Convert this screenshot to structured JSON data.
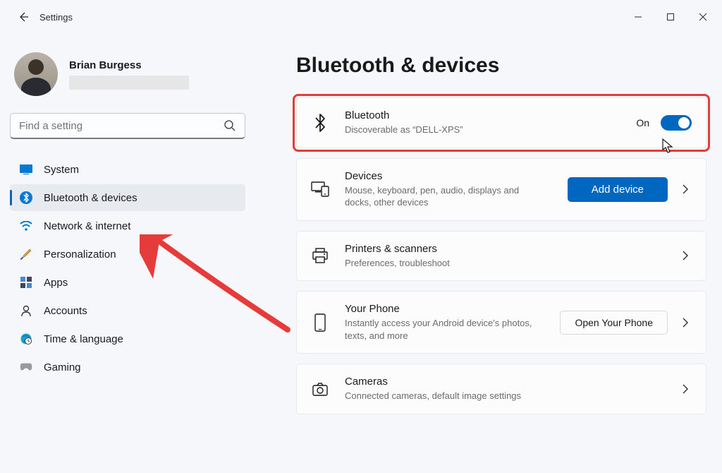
{
  "window": {
    "title": "Settings"
  },
  "profile": {
    "name": "Brian Burgess"
  },
  "search": {
    "placeholder": "Find a setting"
  },
  "nav": [
    {
      "id": "system",
      "label": "System"
    },
    {
      "id": "bluetooth",
      "label": "Bluetooth & devices"
    },
    {
      "id": "network",
      "label": "Network & internet"
    },
    {
      "id": "personalization",
      "label": "Personalization"
    },
    {
      "id": "apps",
      "label": "Apps"
    },
    {
      "id": "accounts",
      "label": "Accounts"
    },
    {
      "id": "time",
      "label": "Time & language"
    },
    {
      "id": "gaming",
      "label": "Gaming"
    }
  ],
  "page": {
    "title": "Bluetooth & devices"
  },
  "cards": {
    "bluetooth": {
      "title": "Bluetooth",
      "subtitle": "Discoverable as “DELL-XPS”",
      "toggle_label": "On",
      "toggle_state": true
    },
    "devices": {
      "title": "Devices",
      "subtitle": "Mouse, keyboard, pen, audio, displays and docks, other devices",
      "button": "Add device"
    },
    "printers": {
      "title": "Printers & scanners",
      "subtitle": "Preferences, troubleshoot"
    },
    "phone": {
      "title": "Your Phone",
      "subtitle": "Instantly access your Android device's photos, texts, and more",
      "button": "Open Your Phone"
    },
    "cameras": {
      "title": "Cameras",
      "subtitle": "Connected cameras, default image settings"
    }
  },
  "colors": {
    "accent": "#0067c0",
    "highlight": "#e63b3b"
  }
}
